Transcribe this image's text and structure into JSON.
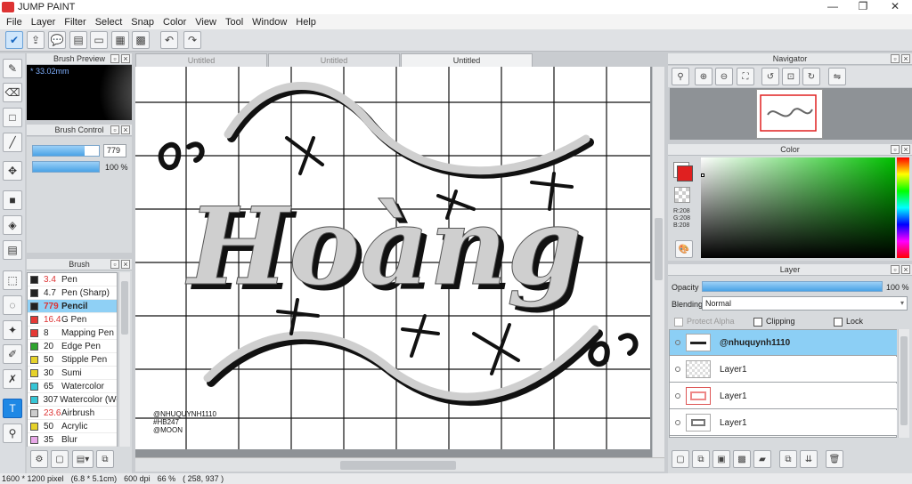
{
  "app": {
    "title": "JUMP PAINT"
  },
  "window_controls": {
    "minimize": "—",
    "maximize": "❐",
    "close": "✕"
  },
  "menu": [
    "File",
    "Layer",
    "Filter",
    "Select",
    "Snap",
    "Color",
    "View",
    "Tool",
    "Window",
    "Help"
  ],
  "tabs": [
    {
      "label": "Untitled"
    },
    {
      "label": "Untitled"
    },
    {
      "label": "Untitled"
    }
  ],
  "brush_preview": {
    "title": "Brush Preview",
    "size": "* 33.02mm"
  },
  "brush_control": {
    "title": "Brush Control",
    "size_value": "779",
    "opacity_value": "100 %",
    "size_fill": 0.78,
    "opacity_fill": 1.0
  },
  "brush": {
    "title": "Brush",
    "items": [
      {
        "size": "3.4",
        "name": "Pen",
        "color": "#222222",
        "red": true
      },
      {
        "size": "4.7",
        "name": "Pen (Sharp)",
        "color": "#222222",
        "red": false
      },
      {
        "size": "779",
        "name": "Pencil",
        "color": "#222222",
        "red": true,
        "selected": true
      },
      {
        "size": "16.4",
        "name": "G Pen",
        "color": "#e53935",
        "red": true
      },
      {
        "size": "8",
        "name": "Mapping Pen",
        "color": "#e53935",
        "red": false
      },
      {
        "size": "20",
        "name": "Edge Pen",
        "color": "#2ea52e",
        "red": false
      },
      {
        "size": "50",
        "name": "Stipple Pen",
        "color": "#e6d22a",
        "red": false
      },
      {
        "size": "30",
        "name": "Sumi",
        "color": "#e6d22a",
        "red": false
      },
      {
        "size": "65",
        "name": "Watercolor",
        "color": "#36c6d6",
        "red": false
      },
      {
        "size": "307",
        "name": "Watercolor (We",
        "color": "#36c6d6",
        "red": false
      },
      {
        "size": "23.6",
        "name": "Airbrush",
        "color": "#cccccc",
        "red": true
      },
      {
        "size": "50",
        "name": "Acrylic",
        "color": "#e6d22a",
        "red": false
      },
      {
        "size": "35",
        "name": "Blur",
        "color": "#e8a8e8",
        "red": false
      }
    ]
  },
  "canvas": {
    "title_text": "Hoàng",
    "watermark": [
      "@NHUQUYNH1110",
      "#HB247",
      "@MOON"
    ]
  },
  "navigator": {
    "title": "Navigator"
  },
  "color": {
    "title": "Color",
    "r": "R:208",
    "g": "G:208",
    "b": "B:208",
    "primary": "#e02020"
  },
  "layer": {
    "title": "Layer",
    "opacity_label": "Opacity",
    "opacity_value": "100 %",
    "opacity_fill": 1.0,
    "blending_label": "Blending",
    "blending_value": "Normal",
    "protect_alpha": "Protect Alpha",
    "clipping": "Clipping",
    "lock": "Lock",
    "layers": [
      {
        "name": "@nhuquynh1110",
        "selected": true
      },
      {
        "name": "Layer1",
        "selected": false
      },
      {
        "name": "Layer1",
        "selected": false
      },
      {
        "name": "Layer1",
        "selected": false
      }
    ]
  },
  "status": {
    "pixels": "1600 * 1200 pixel",
    "cm": "(6.8 * 5.1cm)",
    "dpi": "600 dpi",
    "zoom": "66 %",
    "coords": "( 258, 937 )"
  }
}
